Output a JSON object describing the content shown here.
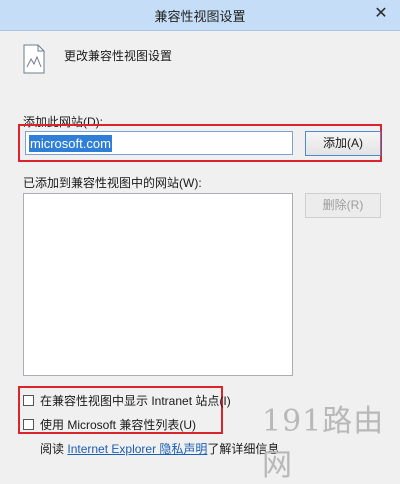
{
  "window": {
    "title": "兼容性视图设置",
    "close_symbol": "✕"
  },
  "header": {
    "icon": "page-icon",
    "text": "更改兼容性视图设置"
  },
  "add_site": {
    "label": "添加此网站(D):",
    "input_value": "microsoft.com",
    "add_button": "添加(A)"
  },
  "added_sites": {
    "label": "已添加到兼容性视图中的网站(W):",
    "items": [],
    "remove_button": "删除(R)"
  },
  "options": {
    "intranet": "在兼容性视图中显示 Intranet 站点(I)",
    "ms_list": "使用 Microsoft 兼容性列表(U)"
  },
  "footer": {
    "prefix": "阅读",
    "link": "Internet Explorer 隐私声明",
    "suffix": "了解详细信息"
  },
  "watermark": "191路由网",
  "colors": {
    "highlight_box": "#d9252b",
    "titlebar": "#c5ddf6",
    "link": "#1a5fb4"
  }
}
